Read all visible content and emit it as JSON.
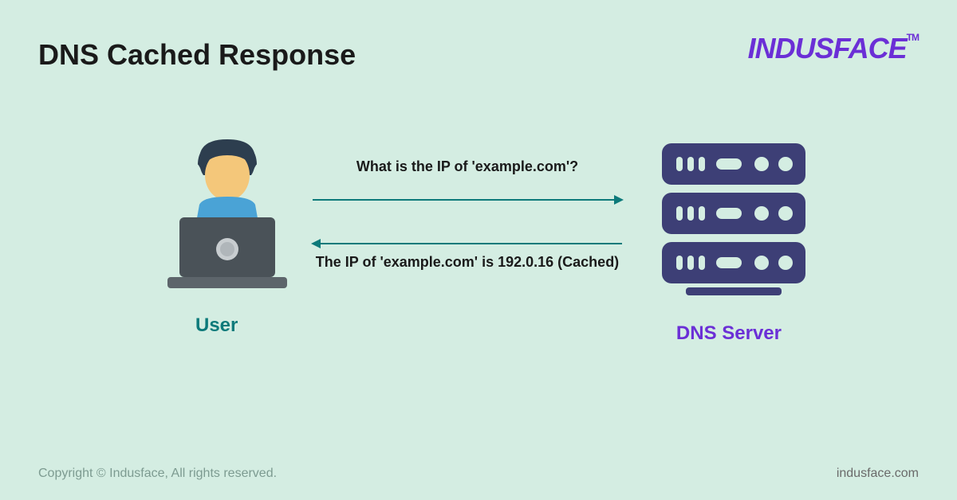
{
  "title": "DNS Cached Response",
  "logo": {
    "text": "INDUSFACE",
    "tm": "TM"
  },
  "user": {
    "label": "User"
  },
  "server": {
    "label": "DNS Server"
  },
  "query": "What is the IP of 'example.com'?",
  "response": "The IP of 'example.com' is 192.0.16 (Cached)",
  "copyright": "Copyright © Indusface, All rights reserved.",
  "website": "indusface.com"
}
